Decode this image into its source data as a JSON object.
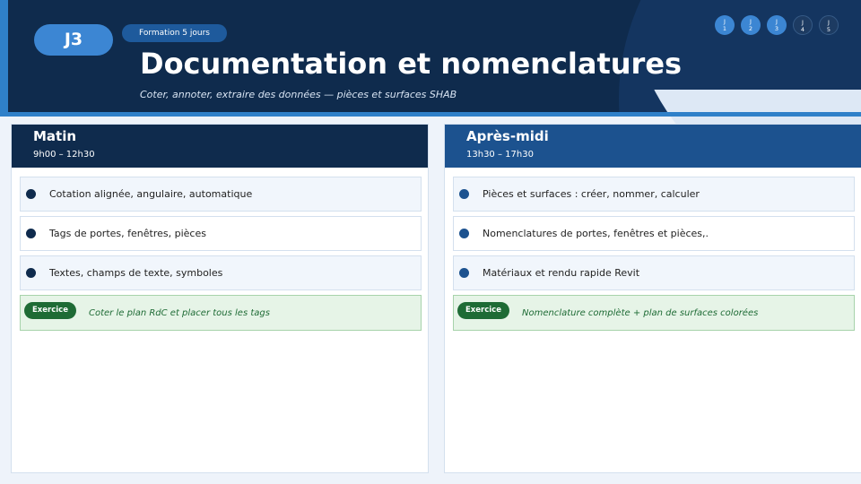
{
  "header": {
    "day_badge": "J3",
    "formation_pill": "Formation 5 jours",
    "title": "Documentation et nomenclatures",
    "subtitle": "Coter, annoter, extraire des données — pièces et surfaces SHAB"
  },
  "steps": [
    {
      "letter": "J",
      "number": "1",
      "status": "done"
    },
    {
      "letter": "J",
      "number": "2",
      "status": "done"
    },
    {
      "letter": "J",
      "number": "3",
      "status": "current"
    },
    {
      "letter": "J",
      "number": "4",
      "status": "todo"
    },
    {
      "letter": "J",
      "number": "5",
      "status": "todo"
    }
  ],
  "colors": {
    "navy": "#0f2b4d",
    "blue": "#1c528f",
    "accent": "#3c86d3",
    "exercise_green": "#1e6b35"
  },
  "morning": {
    "title": "Matin",
    "time": "9h00 – 12h30",
    "items": [
      "Cotation alignée, angulaire, automatique",
      "Tags de portes, fenêtres, pièces",
      "Textes, champs de texte, symboles"
    ],
    "exercise_label": "Exercice",
    "exercise_text": "Coter le plan RdC et placer tous les tags"
  },
  "afternoon": {
    "title": "Après-midi",
    "time": "13h30 – 17h30",
    "items": [
      "Pièces et surfaces : créer, nommer, calculer",
      "Nomenclatures de portes, fenêtres et pièces,.",
      "Matériaux et rendu rapide Revit"
    ],
    "exercise_label": "Exercice",
    "exercise_text": "Nomenclature complète + plan de surfaces colorées"
  }
}
